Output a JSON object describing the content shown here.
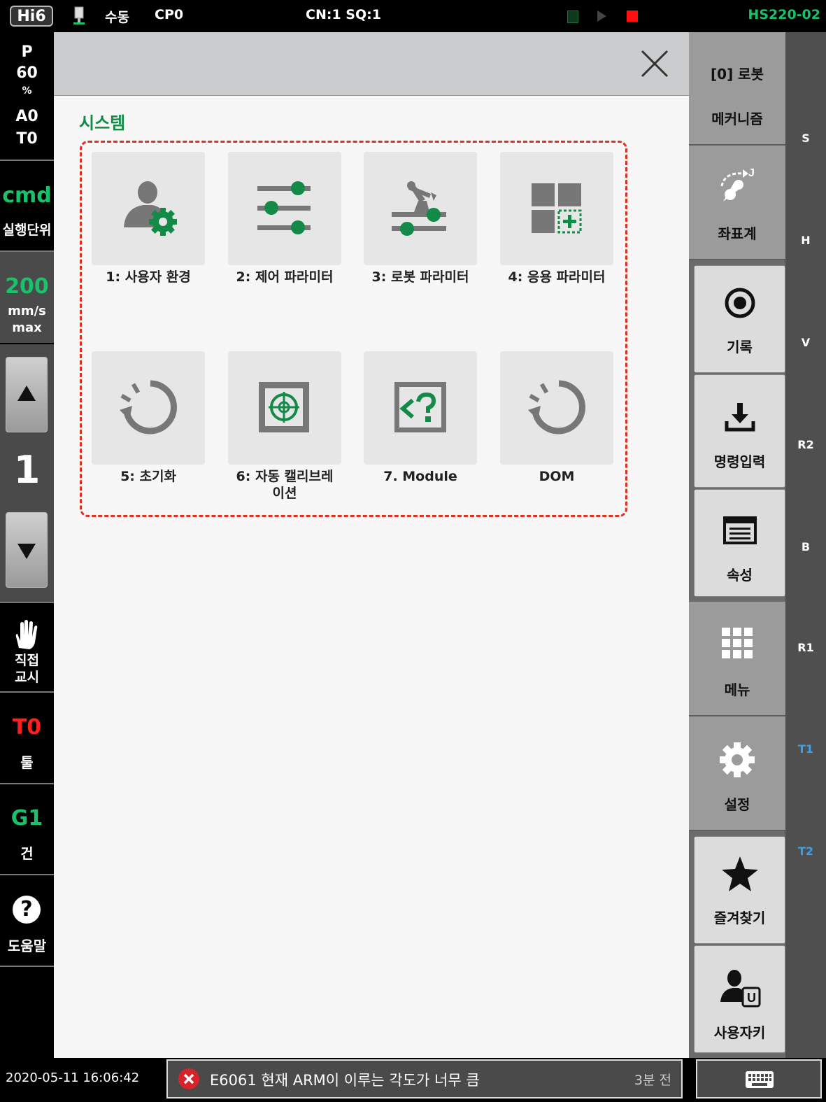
{
  "topbar": {
    "logo": "Hi6",
    "mode": "수동",
    "program": "CP0",
    "step": "CN:1 SQ:1",
    "robot_model": "HS220-02"
  },
  "leftbar": {
    "speed_label_p": "P",
    "speed_value": "60",
    "speed_unit": "%",
    "a_value": "A0",
    "t_value": "T0",
    "cmd": "cmd",
    "cmd_sub": "실행단위",
    "max_speed": "200",
    "max_speed_unit": "mm/s",
    "max_speed_max": "max",
    "step_number": "1",
    "direct_teach": "직접\n교시",
    "tool_value": "T0",
    "tool_label": "툴",
    "gun_value": "G1",
    "gun_label": "건",
    "help_label": "도움말"
  },
  "main": {
    "section_title": "시스템",
    "tiles": [
      {
        "label": "1: 사용자 환경",
        "icon": "user-settings-icon"
      },
      {
        "label": "2: 제어 파라미터",
        "icon": "sliders-icon"
      },
      {
        "label": "3: 로봇 파라미터",
        "icon": "robot-arm-icon"
      },
      {
        "label": "4: 응용 파라미터",
        "icon": "app-grid-add-icon"
      },
      {
        "label": "5: 초기화",
        "icon": "reset-icon"
      },
      {
        "label": "6: 자동 캘리브레\n이션",
        "icon": "calibration-target-icon"
      },
      {
        "label": "7. Module",
        "icon": "module-code-icon"
      },
      {
        "label": "DOM",
        "icon": "reset-icon"
      }
    ]
  },
  "rightpanel": {
    "robot": "[0] 로봇",
    "mechanism": "메커니즘",
    "coord": "좌표계",
    "record": "기록",
    "command_input": "명령입력",
    "properties": "속성",
    "menu": "메뉴",
    "settings": "설정",
    "favorites": "즐겨찾기",
    "user_key": "사용자키",
    "user_key_badge": "U",
    "coord_badge": "J"
  },
  "axis_strip": [
    "S",
    "H",
    "V",
    "R2",
    "B",
    "R1",
    "T1",
    "T2"
  ],
  "bottombar": {
    "datetime": "2020-05-11 16:06:42",
    "message": "E6061 현재 ARM이 이루는 각도가 너무 큼",
    "message_time": "3분 전"
  },
  "colors": {
    "accent_green": "#138a48",
    "error_red": "#e0301e",
    "axis_blue": "#3aa0e8"
  }
}
